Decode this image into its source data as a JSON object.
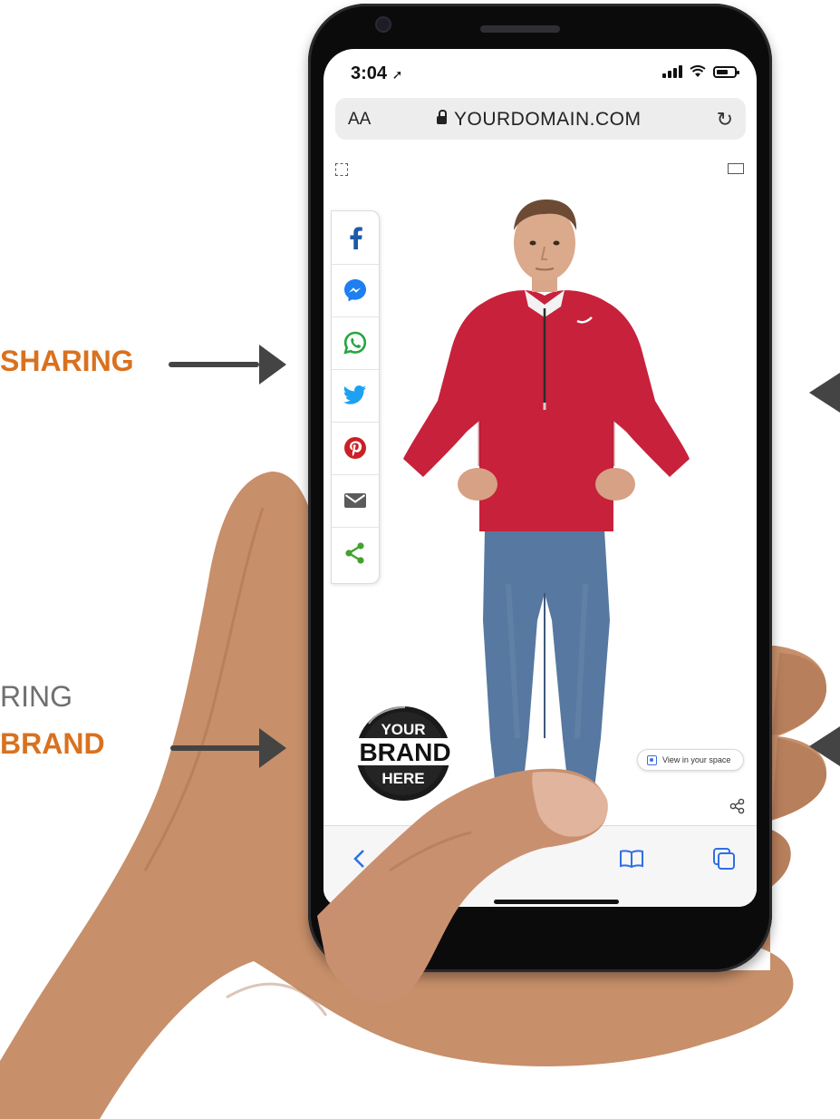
{
  "callouts": {
    "sharing": {
      "text": "SHARING"
    },
    "brand": {
      "line1": "RING",
      "line2": "BRAND"
    }
  },
  "status_bar": {
    "time": "3:04"
  },
  "browser": {
    "text_size_label": "AA",
    "url": "YOURDOMAIN.COM"
  },
  "share_buttons": [
    {
      "name": "facebook",
      "icon": "facebook-icon",
      "color": "#1b5aa8"
    },
    {
      "name": "messenger",
      "icon": "messenger-icon",
      "color": "#1d7ff0"
    },
    {
      "name": "whatsapp",
      "icon": "whatsapp-icon",
      "color": "#27a53f"
    },
    {
      "name": "twitter",
      "icon": "twitter-icon",
      "color": "#1da1f2"
    },
    {
      "name": "pinterest",
      "icon": "pinterest-icon",
      "color": "#cb2027"
    },
    {
      "name": "email",
      "icon": "email-icon",
      "color": "#5b5b5b"
    },
    {
      "name": "share",
      "icon": "share-icon",
      "color": "#43a22f"
    }
  ],
  "brand_badge": {
    "line1": "YOUR",
    "line2": "BRAND",
    "line3": "HERE"
  },
  "ar_button": {
    "label": "View in your space"
  },
  "colors": {
    "accent": "#d9711e",
    "shirt": "#c8213b",
    "jeans": "#5778a0"
  }
}
